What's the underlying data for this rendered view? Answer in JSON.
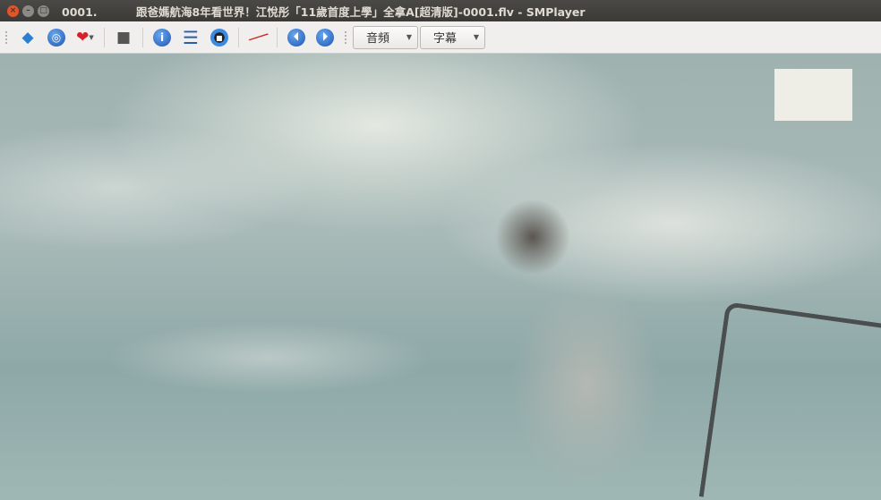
{
  "window": {
    "title": "0001.          跟爸媽航海8年看世界！江悅彤「11歲首度上學」全拿A[超清版]-0001.flv - SMPlayer"
  },
  "toolbar": {
    "buttons": [
      {
        "name": "open-file",
        "icon": "book-icon",
        "glyph": "📘"
      },
      {
        "name": "open-url",
        "icon": "globe-icon",
        "glyph": "🌐"
      },
      {
        "name": "favorites",
        "icon": "heart-icon",
        "glyph": "❤"
      },
      {
        "name": "screenshot",
        "icon": "camera-icon",
        "glyph": "📷"
      },
      {
        "name": "info",
        "icon": "info-icon",
        "glyph": "i"
      },
      {
        "name": "playlist",
        "icon": "list-icon",
        "glyph": "☰"
      },
      {
        "name": "video-settings",
        "icon": "film-icon",
        "glyph": "▣"
      },
      {
        "name": "preferences",
        "icon": "screwdriver-icon",
        "glyph": "🔧"
      },
      {
        "name": "previous",
        "icon": "skip-back-icon",
        "glyph": "⏮"
      },
      {
        "name": "next",
        "icon": "skip-forward-icon",
        "glyph": "⏭"
      }
    ],
    "audio_label": "音頻",
    "subtitle_label": "字幕"
  }
}
